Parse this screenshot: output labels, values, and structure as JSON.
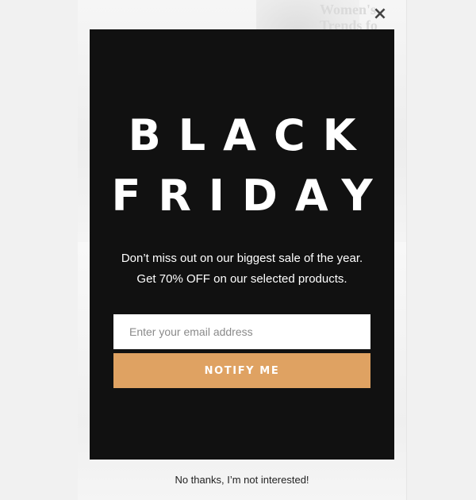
{
  "background_page": {
    "heading_fragment": "Women's Trends fo"
  },
  "popup": {
    "close_icon": "×",
    "headline_line1": "BLACK",
    "headline_line2": "FRIDAY",
    "subtext_line1": "Don’t miss out on our biggest sale of the year.",
    "subtext_line2": "Get 70% OFF on our selected products.",
    "email_placeholder": "Enter your email address",
    "notify_label": "NOTIFY ME",
    "decline_label": "No thanks, I’m not interested!"
  },
  "colors": {
    "modal_background": "#111111",
    "accent_button": "#dfa262",
    "page_background": "#f0f0f0"
  }
}
